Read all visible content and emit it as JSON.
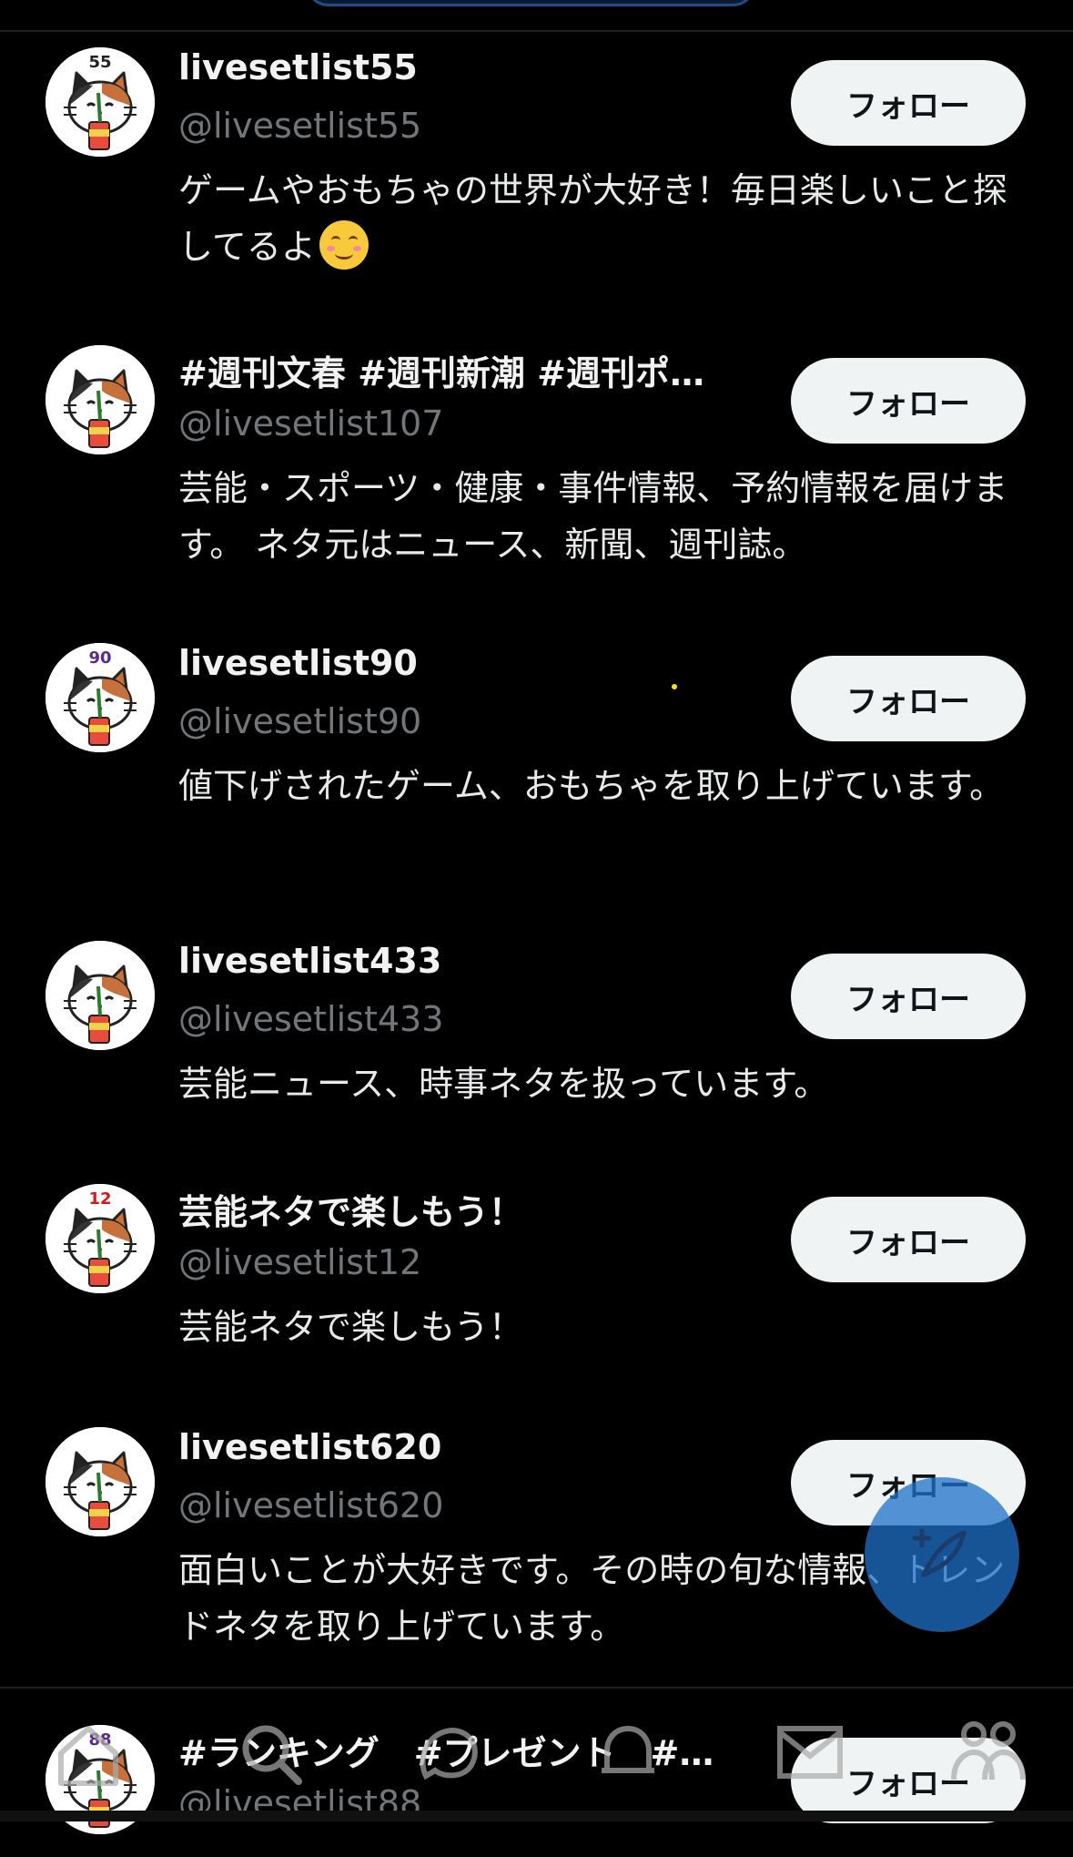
{
  "follow_label": "フォロー",
  "users": [
    {
      "name": "livesetlist55",
      "handle": "@livesetlist55",
      "bio": "ゲームやおもちゃの世界が大好き！毎日楽しいこと探してるよ",
      "bio_emoji": "smiling-face-emoji",
      "badge": "55",
      "badge_color": "#222222"
    },
    {
      "name": "#週刊文春 #週刊新潮 #週刊ポ…",
      "handle": "@livesetlist107",
      "bio": "芸能・スポーツ・健康・事件情報、予約情報を届けます。 ネタ元はニュース、新聞、週刊誌。",
      "badge": "",
      "badge_color": "#222222"
    },
    {
      "name": "livesetlist90",
      "handle": "@livesetlist90",
      "bio": "値下げされたゲーム、おもちゃを取り上げています。",
      "badge": "90",
      "badge_color": "#5b2a8c"
    },
    {
      "name": "livesetlist433",
      "handle": "@livesetlist433",
      "bio": "芸能ニュース、時事ネタを扱っています。",
      "badge": "",
      "badge_color": "#222222"
    },
    {
      "name": "芸能ネタで楽しもう！",
      "handle": "@livesetlist12",
      "bio": "芸能ネタで楽しもう！",
      "badge": "12",
      "badge_color": "#d11a1a"
    },
    {
      "name": "livesetlist620",
      "handle": "@livesetlist620",
      "bio": "面白いことが大好きです。その時の旬な情報、トレンドネタを取り上げています。",
      "badge": "",
      "badge_color": "#222222"
    },
    {
      "name": "#ランキング　#プレゼント　#…",
      "handle": "@livesetlist88",
      "bio": "",
      "badge": "88",
      "badge_color": "#5b2a8c"
    }
  ],
  "nav": [
    "home-icon",
    "search-icon",
    "spaces-icon",
    "notifications-icon",
    "messages-icon",
    "communities-icon"
  ],
  "colors": {
    "background": "#000000",
    "follow_bg": "#eff3f4",
    "handle": "#71767b",
    "fab": "#1d70c8"
  }
}
